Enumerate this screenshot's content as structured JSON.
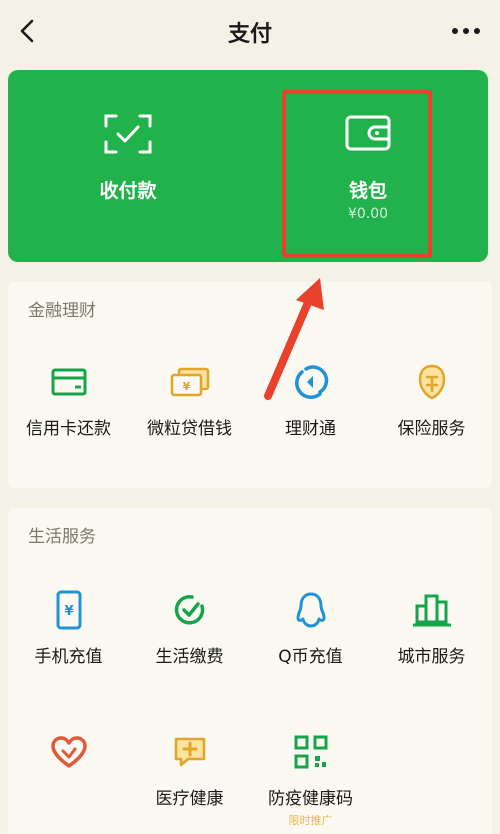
{
  "header": {
    "title": "支付"
  },
  "pay_card": {
    "receive": {
      "label": "收付款"
    },
    "wallet": {
      "label": "钱包",
      "balance": "¥0.00"
    }
  },
  "finance": {
    "title": "金融理财",
    "items": [
      {
        "label": "信用卡还款",
        "icon": "credit-card-icon"
      },
      {
        "label": "微粒贷借钱",
        "icon": "loan-icon"
      },
      {
        "label": "理财通",
        "icon": "wealth-icon"
      },
      {
        "label": "保险服务",
        "icon": "insurance-icon"
      }
    ]
  },
  "life": {
    "title": "生活服务",
    "items": [
      {
        "label": "手机充值",
        "icon": "phone-topup-icon"
      },
      {
        "label": "生活缴费",
        "icon": "utility-bill-icon"
      },
      {
        "label": "Q币充值",
        "icon": "qq-coin-icon"
      },
      {
        "label": "城市服务",
        "icon": "city-service-icon"
      },
      {
        "label": "",
        "icon": "charity-icon"
      },
      {
        "label": "医疗健康",
        "icon": "medical-icon"
      },
      {
        "label": "防疫健康码",
        "icon": "health-code-icon",
        "sub": "限时推广"
      }
    ]
  },
  "colors": {
    "brand_green": "#22b24c",
    "highlight_red": "#e8412c",
    "page_bg": "#f4f1e6"
  }
}
